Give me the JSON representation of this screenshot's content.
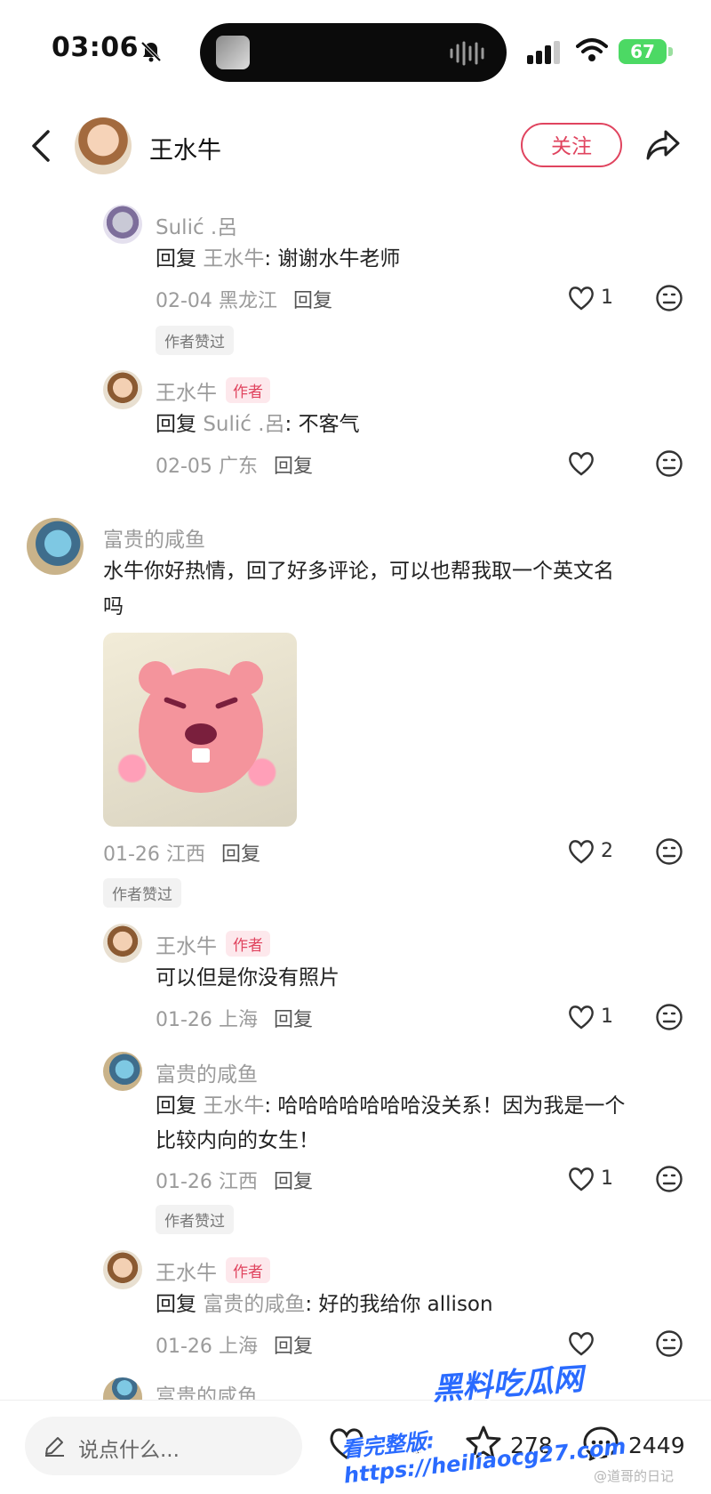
{
  "status_bar": {
    "time": "03:06",
    "battery": "67"
  },
  "header": {
    "user_name": "王水牛",
    "follow_label": "关注"
  },
  "comments": [
    {
      "name": "Sulić .呂",
      "reply_prefix": "回复",
      "reply_target": "王水牛",
      "text": ": 谢谢水牛老师",
      "date": "02-04",
      "location": "黑龙江",
      "reply_label": "回复",
      "likes": "1",
      "badge": "作者赞过"
    },
    {
      "name": "王水牛",
      "author_tag": "作者",
      "reply_prefix": "回复",
      "reply_target": "Sulić .呂",
      "text": ": 不客气",
      "date": "02-05",
      "location": "广东",
      "reply_label": "回复"
    },
    {
      "name": "富贵的咸鱼",
      "text_line1": "水牛你好热情，回了好多评论，可以也帮我取一个英文名",
      "text_line2": "吗",
      "date": "01-26",
      "location": "江西",
      "reply_label": "回复",
      "likes": "2",
      "badge": "作者赞过"
    },
    {
      "name": "王水牛",
      "author_tag": "作者",
      "text": "可以但是你没有照片",
      "date": "01-26",
      "location": "上海",
      "reply_label": "回复",
      "likes": "1"
    },
    {
      "name": "富贵的咸鱼",
      "reply_prefix": "回复",
      "reply_target": "王水牛",
      "text_line1": ": 哈哈哈哈哈哈哈没关系！因为我是一个",
      "text_line2": "比较内向的女生！",
      "date": "01-26",
      "location": "江西",
      "reply_label": "回复",
      "likes": "1",
      "badge": "作者赞过"
    },
    {
      "name": "王水牛",
      "author_tag": "作者",
      "reply_prefix": "回复",
      "reply_target": "富贵的咸鱼",
      "text": ": 好的我给你 allison",
      "date": "01-26",
      "location": "上海",
      "reply_label": "回复"
    },
    {
      "name": "富贵的咸鱼"
    }
  ],
  "bottom_bar": {
    "input_placeholder": "说点什么...",
    "like_count_partial": "8",
    "collect_count": "278",
    "comment_count": "2449"
  },
  "overlay": {
    "watermark_site": "黑料吃瓜网",
    "watermark_url": "看完整版: https://heiliaocg27.com",
    "weibo_mark": "@道哥的日记"
  },
  "icons": {
    "back": "chevron-left-icon",
    "share": "share-icon",
    "heart": "heart-icon",
    "dislike": "dislike-face-icon",
    "collect": "star-icon",
    "comment": "comment-bubble-icon",
    "edit": "pencil-icon"
  },
  "colors": {
    "accent": "#e0445f",
    "muted": "#9b9b9b",
    "battery": "#4cd964"
  }
}
